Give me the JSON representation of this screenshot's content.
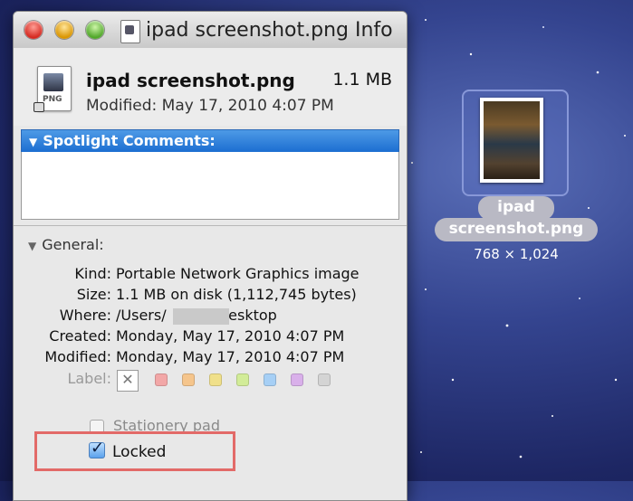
{
  "window": {
    "title": "ipad screenshot.png Info",
    "file_name": "ipad screenshot.png",
    "file_size": "1.1 MB",
    "modified_summary": "Modified: May 17, 2010 4:07 PM",
    "file_ext": "PNG"
  },
  "spotlight": {
    "label": "Spotlight Comments:",
    "comment": ""
  },
  "general": {
    "label": "General:",
    "fields": [
      {
        "label": "Kind:",
        "value": "Portable Network Graphics image"
      },
      {
        "label": "Size:",
        "value": "1.1 MB on disk (1,112,745 bytes)"
      },
      {
        "label": "Where:",
        "value": "/Users/          /Desktop"
      },
      {
        "label": "Created:",
        "value": "Monday, May 17, 2010 4:07 PM"
      },
      {
        "label": "Modified:",
        "value": "Monday, May 17, 2010 4:07 PM"
      }
    ],
    "label_field": "Label:",
    "label_colors": [
      "#f2a7a7",
      "#f5c58c",
      "#f0e08a",
      "#d2ec98",
      "#a6cff5",
      "#d9b0ea",
      "#d4d4d4"
    ],
    "stationery": "Stationery pad",
    "locked": "Locked",
    "locked_checked": true
  },
  "desktop": {
    "icon_label_line1": "ipad",
    "icon_label_line2": "screenshot.png",
    "dimensions": "768 × 1,024"
  }
}
